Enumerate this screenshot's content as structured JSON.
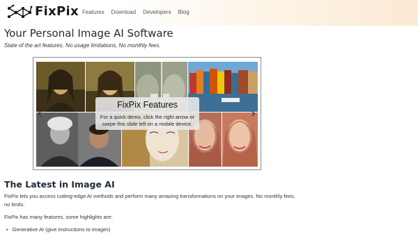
{
  "header": {
    "brand": "FixPix",
    "logo_icon": "molecule-network-icon",
    "nav": [
      {
        "label": "Features"
      },
      {
        "label": "Download"
      },
      {
        "label": "Developers"
      },
      {
        "label": "Blog"
      }
    ]
  },
  "hero": {
    "title": "Your Personal Image AI Software",
    "subtitle": "State of the art features. No usage limitations, No monthly fees."
  },
  "slider": {
    "overlay_title": "FixPix Features",
    "overlay_text": "For a quick demo, click the right arrow or swipe this slide left on a mobile device.",
    "prev_icon": "chevron-left-icon",
    "next_icon": "chevron-right-icon",
    "prev_glyph": "‹",
    "next_glyph": "›"
  },
  "section": {
    "heading": "The Latest in Image AI",
    "paragraph1": "FixPix lets you access cutting-edge AI methods and perform many amazing transformations on your images. No monthly fees, no limits.",
    "paragraph2": "FixPix has many features, some highlights are:",
    "list": [
      {
        "bullet": "•",
        "text": "Generative AI (give instructions to images)"
      }
    ]
  }
}
